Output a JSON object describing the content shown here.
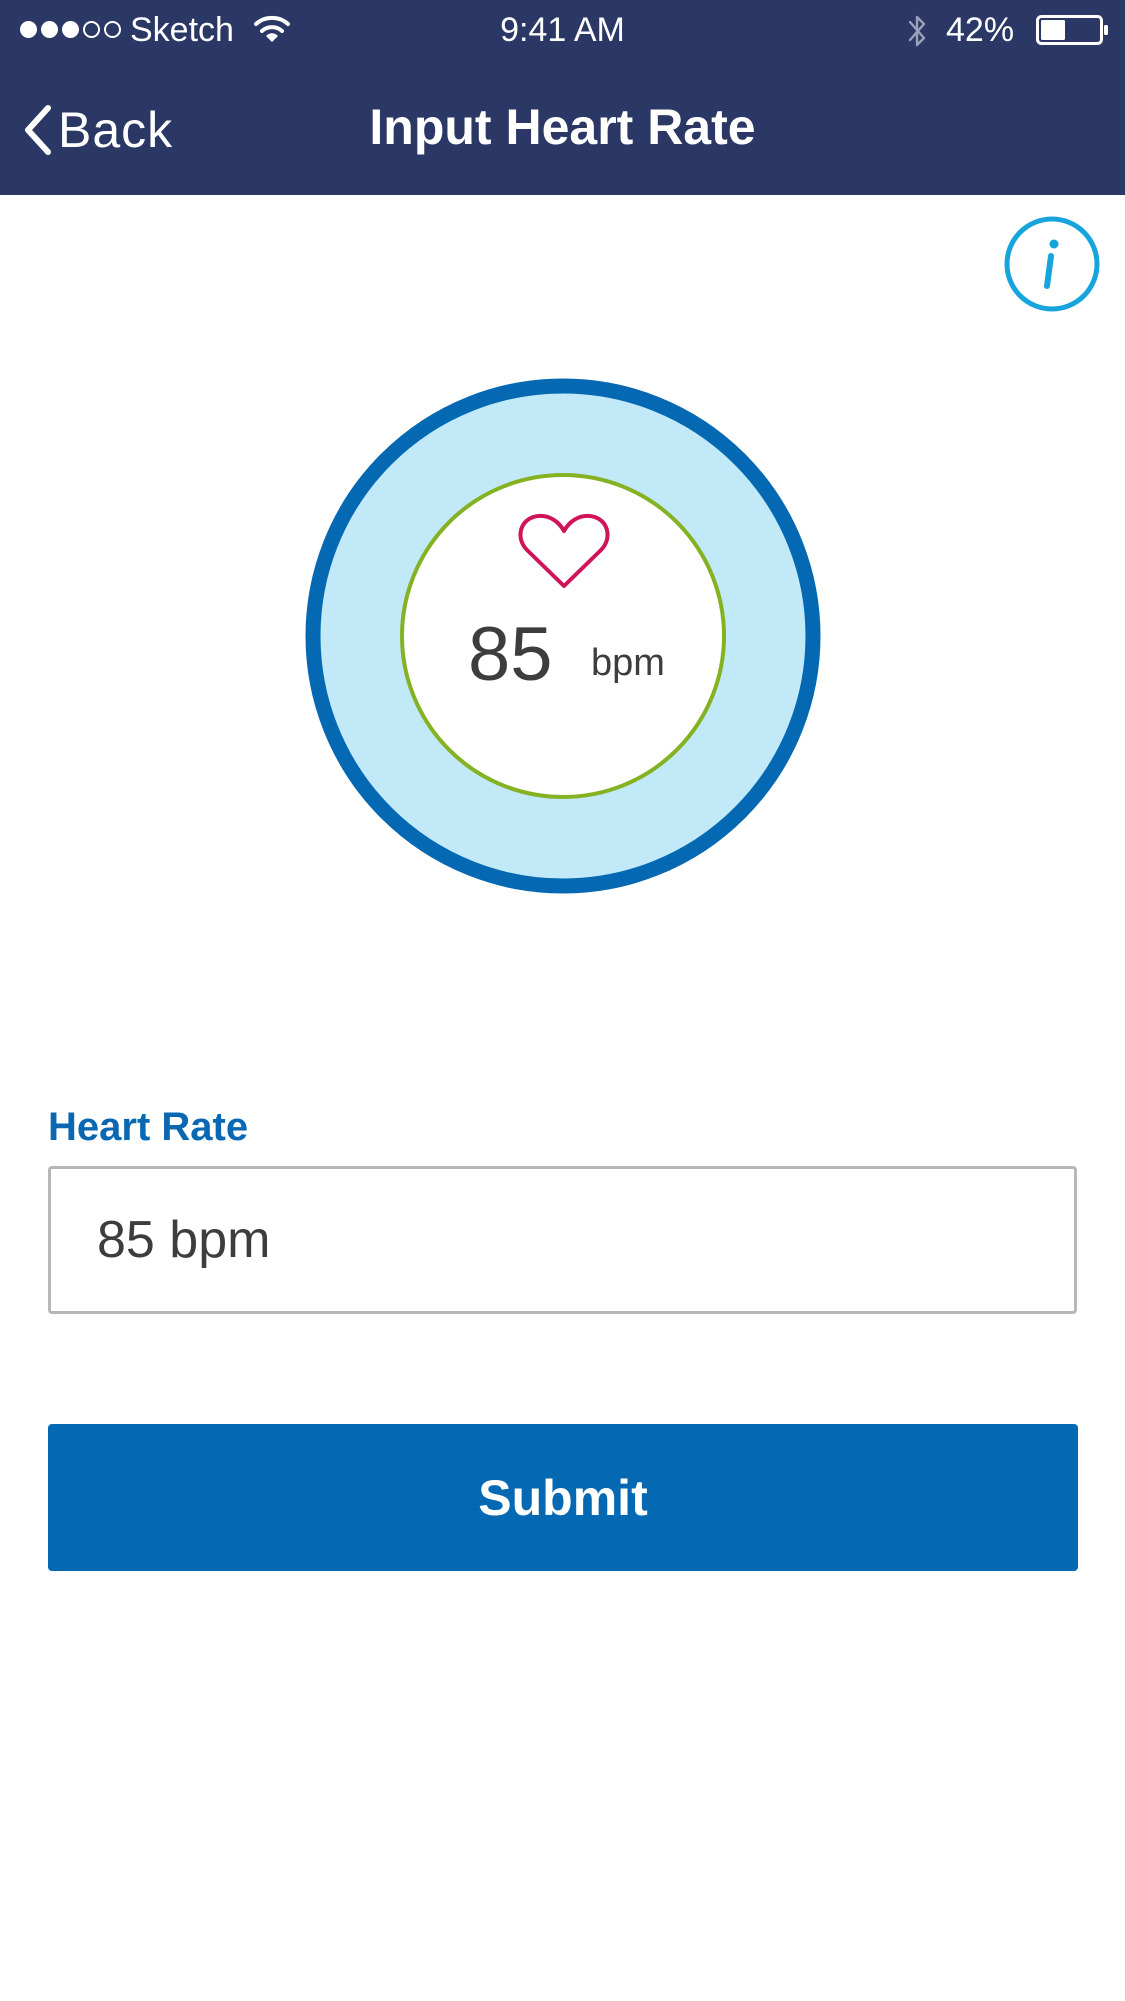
{
  "status_bar": {
    "signal_filled": 3,
    "signal_total": 5,
    "carrier": "Sketch",
    "time": "9:41 AM",
    "battery_percent": "42%",
    "battery_level": 0.42
  },
  "nav": {
    "back_label": "Back",
    "title": "Input Heart Rate"
  },
  "gauge": {
    "value": "85",
    "unit": "bpm"
  },
  "form": {
    "label": "Heart Rate",
    "value": "85 bpm"
  },
  "submit_label": "Submit",
  "icons": {
    "info": "info-icon",
    "heart": "heart-icon",
    "back": "chevron-left-icon",
    "wifi": "wifi-icon",
    "bluetooth": "bluetooth-icon",
    "battery": "battery-icon"
  },
  "colors": {
    "header_bg": "#2b3764",
    "accent_blue": "#0468b2",
    "label_blue": "#0a67b2",
    "info_blue": "#16a4dd",
    "gauge_outer_ring": "#0568b3",
    "gauge_fill": "#c2e9f8",
    "gauge_inner_ring": "#84b222",
    "heart": "#d0145a",
    "text_dark": "#3d3d3d"
  }
}
